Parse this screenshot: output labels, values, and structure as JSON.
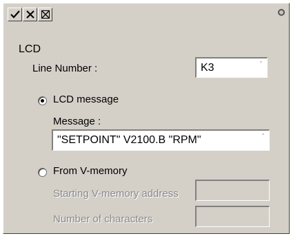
{
  "toolbar": {
    "check_icon": "check-icon",
    "close_icon": "close-icon",
    "help_icon": "help-icon"
  },
  "group": {
    "label": "LCD"
  },
  "line_number": {
    "label": "Line Number :",
    "value": "K3"
  },
  "lcd_message": {
    "radio_label": "LCD message",
    "checked": true,
    "message_label": "Message :",
    "message_value": "\"SETPOINT\" V2100.B \"RPM\""
  },
  "vmemory": {
    "radio_label": "From V-memory",
    "checked": false,
    "starting_label": "Starting V-memory address",
    "starting_value": "",
    "number_label": "Number of characters",
    "number_value": ""
  }
}
